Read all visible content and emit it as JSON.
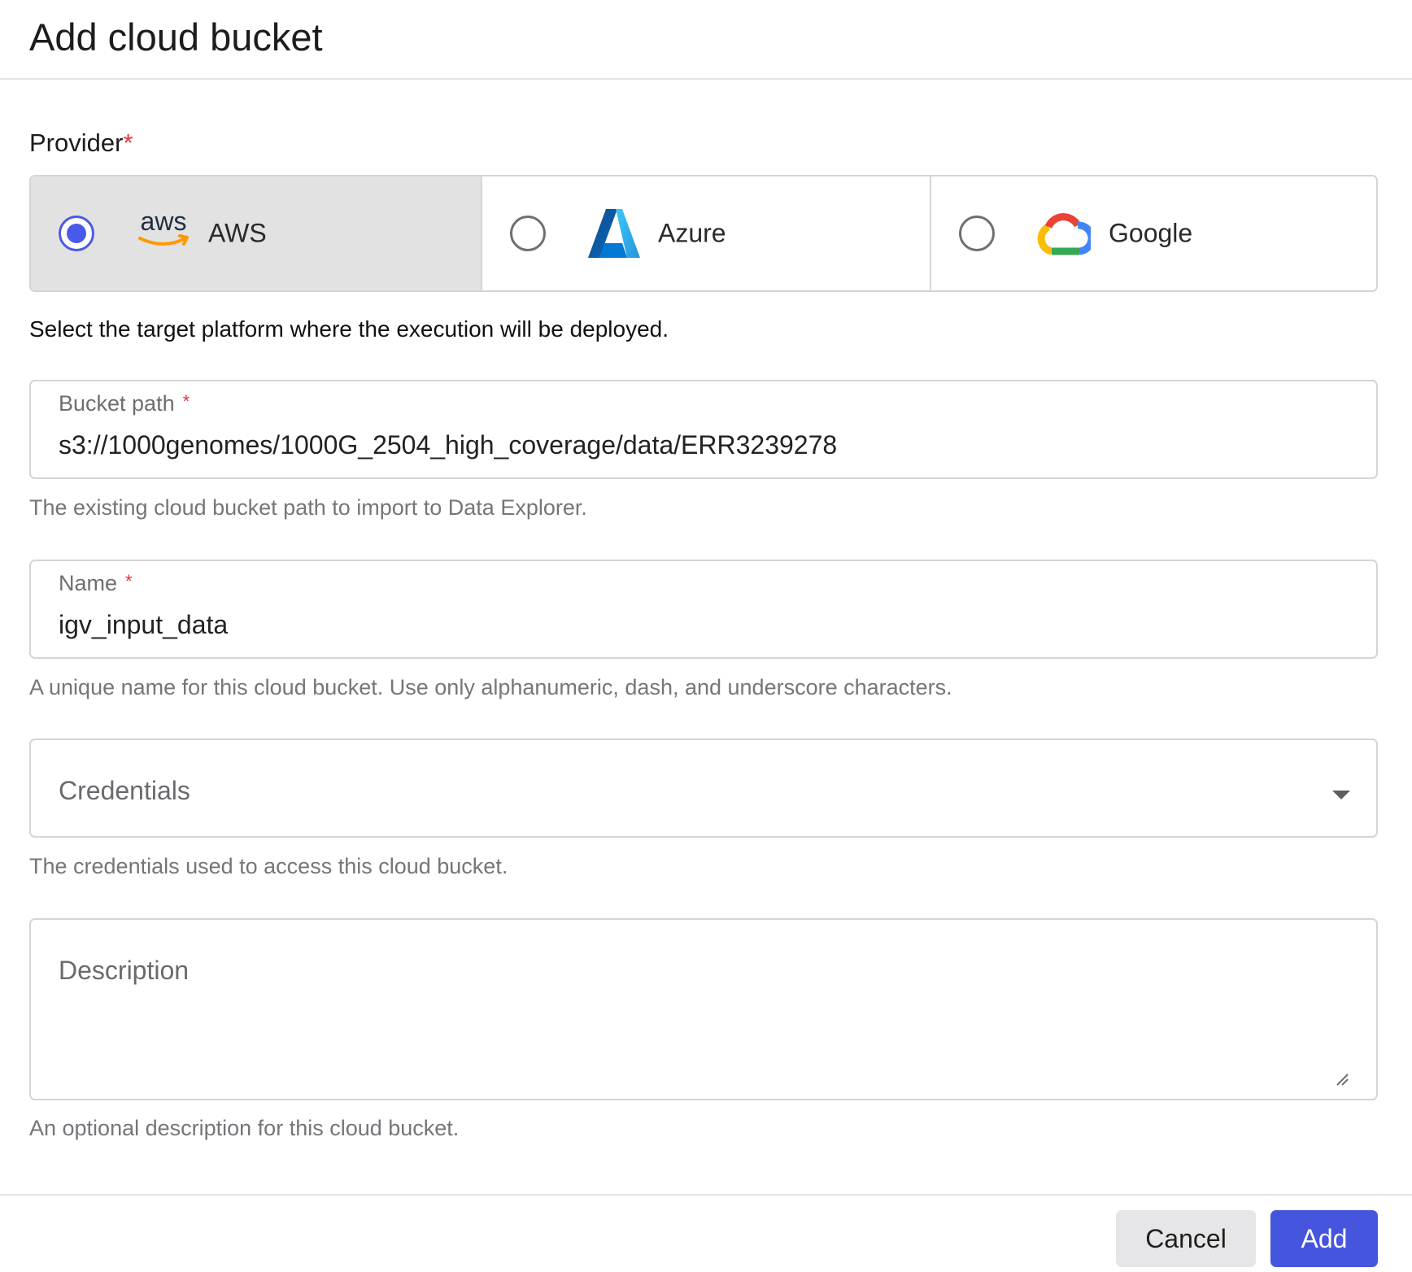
{
  "dialog": {
    "title": "Add cloud bucket"
  },
  "provider": {
    "label": "Provider",
    "required_mark": "*",
    "options": [
      {
        "label": "AWS",
        "logo_text": "aws",
        "icon": "aws-logo-icon",
        "selected": true
      },
      {
        "label": "Azure",
        "icon": "azure-logo-icon",
        "selected": false
      },
      {
        "label": "Google",
        "icon": "google-cloud-logo-icon",
        "selected": false
      }
    ],
    "help": "Select the target platform where the execution will be deployed."
  },
  "bucket_path": {
    "label": "Bucket path",
    "required_mark": "*",
    "value": "s3://1000genomes/1000G_2504_high_coverage/data/ERR3239278",
    "help": "The existing cloud bucket path to import to Data Explorer."
  },
  "name": {
    "label": "Name",
    "required_mark": "*",
    "value": "igv_input_data",
    "help": "A unique name for this cloud bucket. Use only alphanumeric, dash, and underscore characters."
  },
  "credentials": {
    "placeholder": "Credentials",
    "help": "The credentials used to access this cloud bucket."
  },
  "description": {
    "placeholder": "Description",
    "help": "An optional description for this cloud bucket."
  },
  "footer": {
    "cancel_label": "Cancel",
    "add_label": "Add"
  },
  "colors": {
    "accent": "#4655dd",
    "required": "#e0343c",
    "selected_bg": "#e2e2e2"
  }
}
